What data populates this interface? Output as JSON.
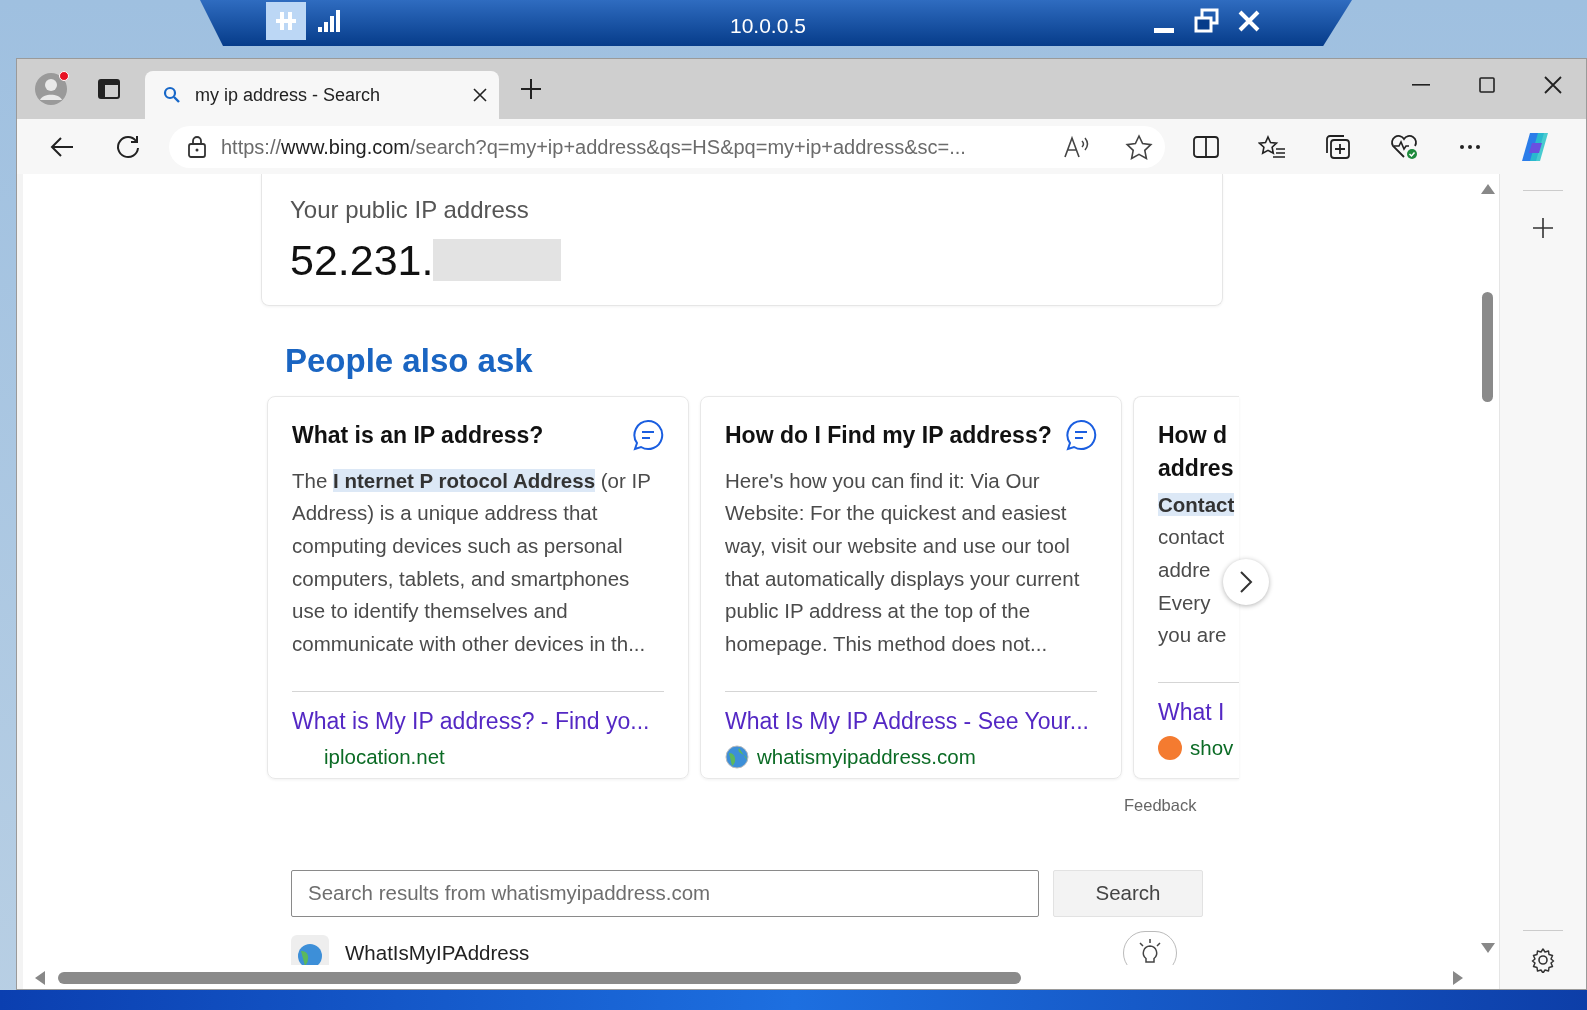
{
  "remote_bar": {
    "title": "10.0.0.5"
  },
  "browser": {
    "profile": {
      "notification": true
    },
    "tabs": [
      {
        "title": "my ip address - Search",
        "selected": true
      }
    ],
    "address": {
      "scheme": "https://",
      "domain": "www.bing.com",
      "path": "/search?q=my+ip+address&qs=HS&pq=my+ip+address&sc=..."
    }
  },
  "page": {
    "ip_card": {
      "label": "Your public IP address",
      "value": "52.231.",
      "redacted": true
    },
    "people_also_ask": {
      "heading": "People also ask",
      "cards": [
        {
          "question": "What is an IP address?",
          "answer": "The **I nternet P rotocol Address** (or IP Address) is a unique address that computing devices such as personal computers, tablets, and smartphones use to identify themselves and communicate with other devices in th...",
          "link": "What is My IP address? - Find yo...",
          "source": "iplocation.net",
          "kind": "blank"
        },
        {
          "question": "How do I Find my IP address?",
          "answer": "Here's how you can find it: Via Our Website: For the quickest and easiest way, visit our website and use our tool that automatically displays your current public IP address at the top of the homepage. This method does not...",
          "link": "What Is My IP Address - See Your...",
          "source": "whatismyipaddress.com",
          "kind": "globe"
        },
        {
          "question": "How d addres",
          "answer": "**Contact** contact addre Every you are",
          "link": "What I",
          "source": "shov",
          "kind": "dot"
        }
      ]
    },
    "feedback": "Feedback",
    "site_search": {
      "placeholder": "Search results from whatismyipaddress.com",
      "button": "Search"
    },
    "results": [
      {
        "title": "WhatIsMyIPAddress"
      }
    ]
  }
}
